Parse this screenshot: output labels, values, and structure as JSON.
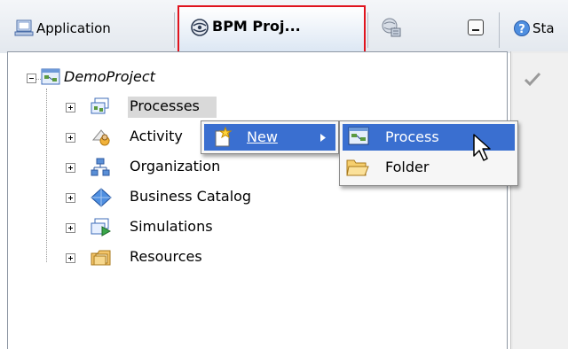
{
  "tabs": [
    {
      "label": "Application",
      "icon": "application-icon"
    },
    {
      "label": "BPM Proj...",
      "icon": "bpm-project-icon",
      "active": true
    },
    {
      "label": "",
      "icon": "navigator-icon"
    },
    {
      "label": "Sta",
      "icon": "help-icon"
    }
  ],
  "tree": {
    "root": {
      "label": "DemoProject",
      "icon": "project-icon"
    },
    "items": [
      {
        "label": "Processes",
        "icon": "processes-icon"
      },
      {
        "label": "Activity",
        "icon": "activity-icon"
      },
      {
        "label": "Organization",
        "icon": "organization-icon"
      },
      {
        "label": "Business Catalog",
        "icon": "business-catalog-icon"
      },
      {
        "label": "Simulations",
        "icon": "simulations-icon"
      },
      {
        "label": "Resources",
        "icon": "resources-icon"
      }
    ]
  },
  "context_menu": {
    "items": [
      {
        "label": "New",
        "icon": "new-icon",
        "has_submenu": true
      }
    ]
  },
  "submenu": {
    "items": [
      {
        "label": "Process",
        "icon": "process-icon",
        "selected": true
      },
      {
        "label": "Folder",
        "icon": "folder-icon"
      }
    ]
  },
  "colors": {
    "selection": "#3a6fd0",
    "highlight_border": "#e0141e"
  }
}
